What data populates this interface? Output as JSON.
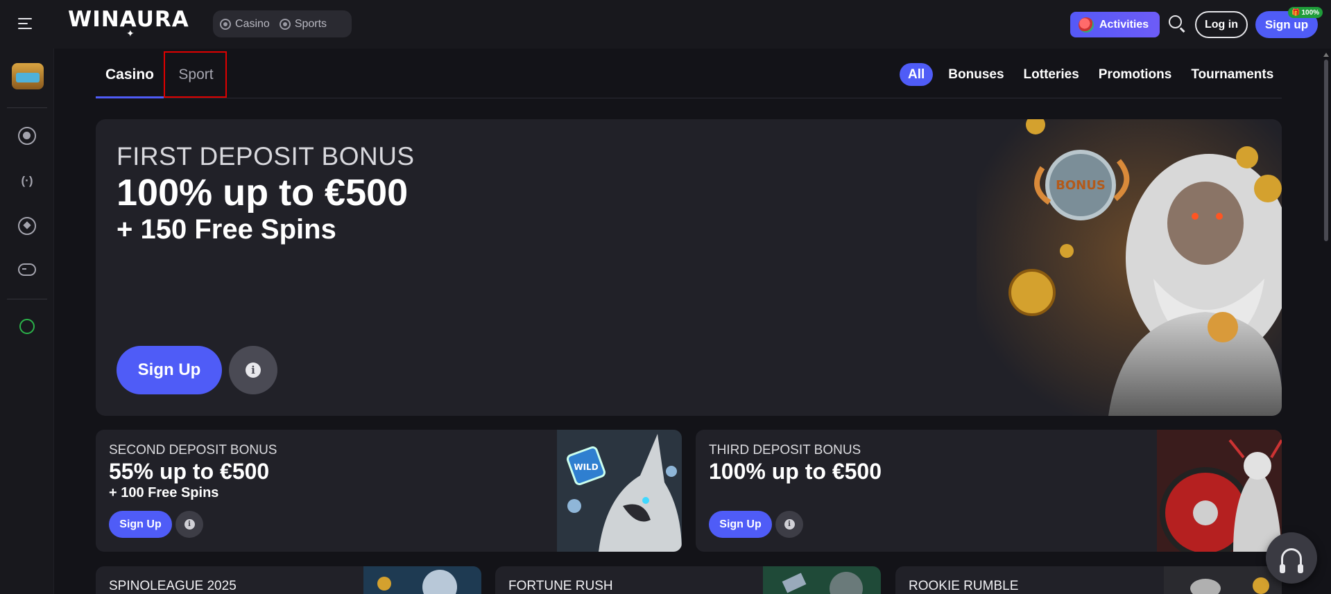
{
  "header": {
    "logo_text": "WINAURA",
    "modes": [
      {
        "label": "Casino",
        "icon": "casino-chip-icon"
      },
      {
        "label": "Sports",
        "icon": "soccer-ball-icon"
      }
    ],
    "activities_label": "Activities",
    "login_label": "Log in",
    "signup_label": "Sign up",
    "signup_badge": "100%"
  },
  "sidebar": {
    "items": [
      {
        "name": "treasure-chest",
        "icon": "treasure-chest-icon"
      },
      {
        "name": "casino",
        "icon": "casino-chip-icon"
      },
      {
        "name": "live",
        "icon": "live-signal-icon"
      },
      {
        "name": "sports",
        "icon": "soccer-ball-icon"
      },
      {
        "name": "esports",
        "icon": "gamepad-icon"
      },
      {
        "name": "support",
        "icon": "headset-icon"
      }
    ]
  },
  "tabs": [
    {
      "label": "Casino",
      "active": true
    },
    {
      "label": "Sport",
      "active": false
    }
  ],
  "filters": [
    {
      "label": "All",
      "active": true
    },
    {
      "label": "Bonuses",
      "active": false
    },
    {
      "label": "Lotteries",
      "active": false
    },
    {
      "label": "Promotions",
      "active": false
    },
    {
      "label": "Tournaments",
      "active": false
    }
  ],
  "hero": {
    "kicker": "FIRST DEPOSIT BONUS",
    "title": "100% up to €500",
    "subtitle": "+ 150 Free Spins",
    "signup_label": "Sign Up",
    "art_badge": "BONUS"
  },
  "cards": [
    {
      "kicker": "SECOND DEPOSIT BONUS",
      "title": "55% up to €500",
      "subtitle": "+ 100 Free Spins",
      "signup_label": "Sign Up",
      "art_badge": "WILD"
    },
    {
      "kicker": "THIRD DEPOSIT BONUS",
      "title": "100% up to €500",
      "subtitle": "",
      "signup_label": "Sign Up"
    }
  ],
  "mini_cards": [
    {
      "title": "SPINOLEAGUE 2025"
    },
    {
      "title": "FORTUNE RUSH"
    },
    {
      "title": "ROOKIE RUMBLE"
    }
  ],
  "colors": {
    "accent": "#4f5cf7",
    "background": "#131318",
    "card": "#212128",
    "highlight_border": "#e00000"
  }
}
